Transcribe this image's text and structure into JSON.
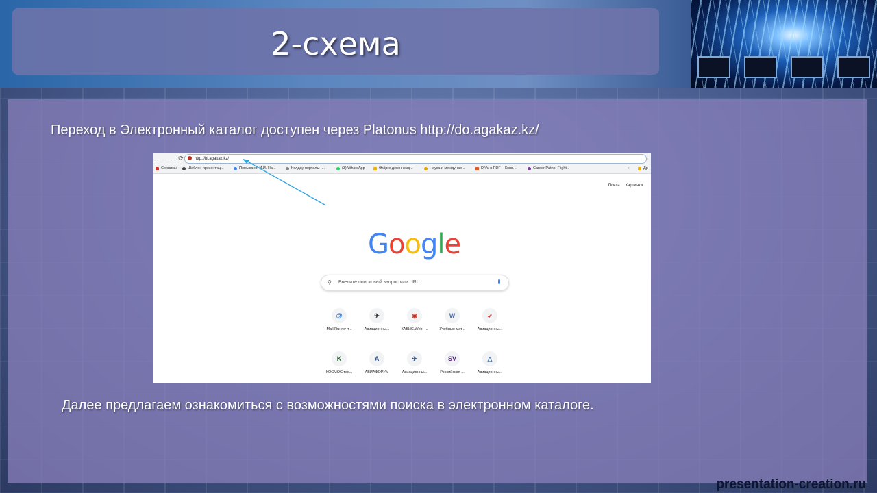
{
  "slide": {
    "title": "2-схема",
    "line1": "Переход в Электронный каталог доступен через Platonus http://do.agakaz.kz/",
    "line2": "Далее предлагаем ознакомиться с возможностями поиска в электронном каталоге.",
    "footer": "presentation-creation.ru"
  },
  "browser": {
    "address": "http://bi.agakaz.kz/",
    "bookmarks": [
      "Сервисы",
      "Шаблон презентац...",
      "Помыкаев. И.И. На...",
      "Колдау порталы |...",
      "(3) WhatsApp",
      "Өмірге деген көзқ...",
      "Наука и междунар...",
      "DjVu в PDF – Конв...",
      "Career Paths: Flight..."
    ],
    "bookmarks_more": "»",
    "bookmarks_last": "Др",
    "toplinks": [
      "Почта",
      "Картинки"
    ],
    "logo": "Google",
    "logo_colors": [
      "#4285f4",
      "#ea4335",
      "#fbbc05",
      "#4285f4",
      "#34a853",
      "#ea4335"
    ],
    "search_placeholder": "Введите поисковый запрос или URL",
    "shortcuts": [
      {
        "label": "Mail.Ru: почт...",
        "glyph": "@"
      },
      {
        "label": "Авиационны...",
        "glyph": "✈"
      },
      {
        "label": "КАБИС.Web -...",
        "glyph": "◉"
      },
      {
        "label": "Учебные мат...",
        "glyph": "W"
      },
      {
        "label": "Авиационны...",
        "glyph": "➶"
      },
      {
        "label": "КОСМОС тех...",
        "glyph": "K"
      },
      {
        "label": "АВИАФОРУМ",
        "glyph": "A"
      },
      {
        "label": "Авиационны...",
        "glyph": "✈"
      },
      {
        "label": "Российская ...",
        "glyph": "SV"
      },
      {
        "label": "Авиационны...",
        "glyph": "△"
      }
    ]
  }
}
